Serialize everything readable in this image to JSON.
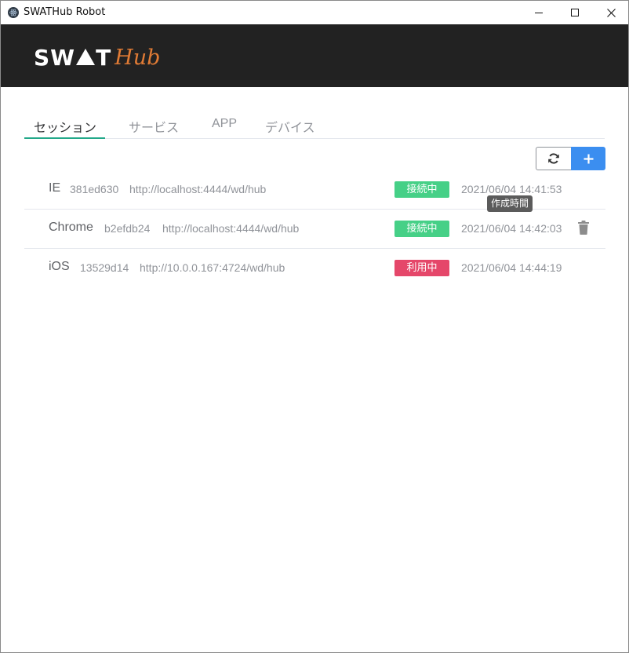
{
  "window": {
    "title": "SWATHub Robot",
    "icon": "app-logo-icon",
    "controls": [
      "minimize-icon",
      "maximize-icon",
      "close-icon"
    ]
  },
  "header": {
    "logo_part1": "SW",
    "logo_part2": "T",
    "logo_hub": "Hub",
    "background": "#222222",
    "accent": "#e07b35"
  },
  "tabs": [
    {
      "label": "セッション",
      "active": true
    },
    {
      "label": "サービス",
      "active": false
    },
    {
      "label": "APP",
      "active": false
    },
    {
      "label": "デバイス",
      "active": false
    }
  ],
  "toolbar": {
    "refresh_icon": "refresh-icon",
    "add_icon": "plus-icon",
    "add_color": "#3b8ef0"
  },
  "sessions": [
    {
      "name": "IE",
      "id": "381ed630",
      "url": "http://localhost:4444/wd/hub",
      "status": "接続中",
      "status_color": "#46d087",
      "created": "2021/06/04 14:41:53"
    },
    {
      "name": "Chrome",
      "id": "b2efdb24",
      "url": "http://localhost:4444/wd/hub",
      "status": "接続中",
      "status_color": "#46d087",
      "created": "2021/06/04 14:42:03",
      "hovered": true
    },
    {
      "name": "iOS",
      "id": "13529d14",
      "url": "http://10.0.0.167:4724/wd/hub",
      "status": "利用中",
      "status_color": "#e5476a",
      "created": "2021/06/04 14:44:19"
    }
  ],
  "tooltip": {
    "text": "作成時間"
  }
}
